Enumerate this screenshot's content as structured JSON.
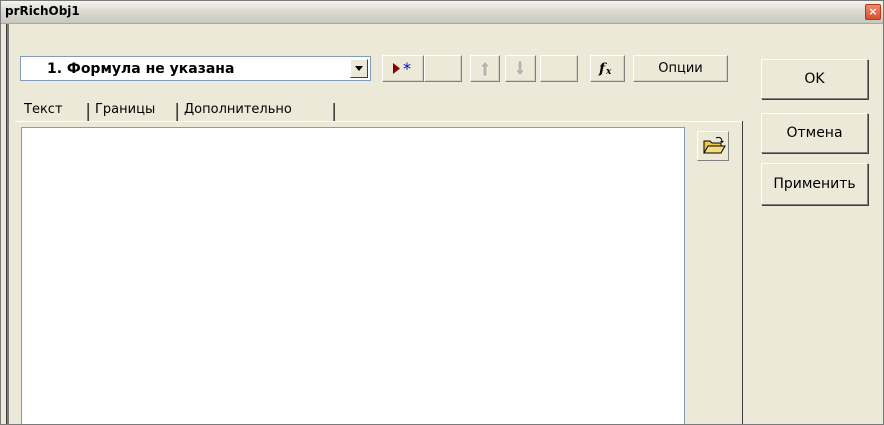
{
  "window": {
    "title": "prRichObj1",
    "close_glyph": "×"
  },
  "formula_selector": {
    "value": "1.  Формула не указана"
  },
  "toolbar": {
    "add_icon": "add-formula-icon",
    "up_icon": "arrow-up-icon",
    "down_icon": "arrow-down-icon",
    "fx_label": "fx",
    "options_label": "Опции"
  },
  "tabs": [
    {
      "label": "Текст",
      "active": true
    },
    {
      "label": "Границы",
      "active": false
    },
    {
      "label": "Дополнительно",
      "active": false
    }
  ],
  "editor": {
    "value": "",
    "open_icon": "open-folder-icon"
  },
  "buttons": {
    "ok": "OK",
    "cancel": "Отмена",
    "apply": "Применить"
  },
  "colors": {
    "add_marker": "#8b0000",
    "add_star": "#0000cc",
    "folder": "#e8c84a"
  }
}
